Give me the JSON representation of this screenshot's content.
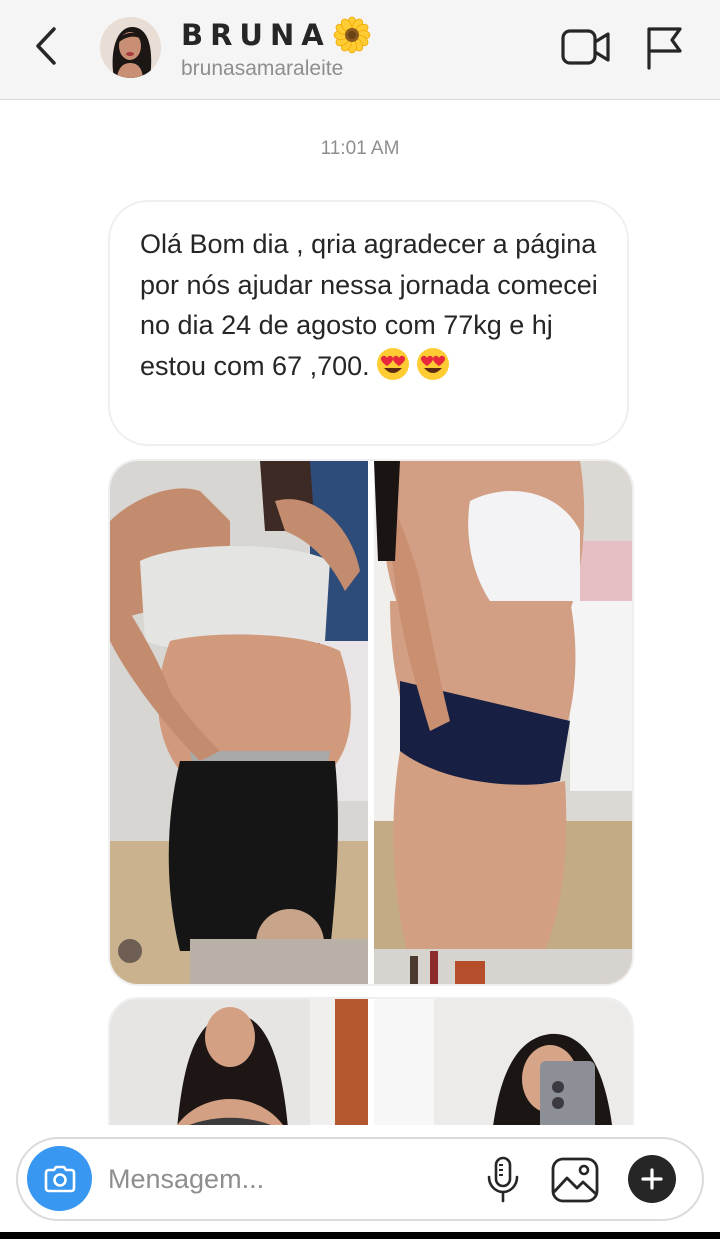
{
  "header": {
    "title": "BRUNA",
    "username": "brunasamaraleite",
    "icons": {
      "back": "chevron-left-icon",
      "video": "video-camera-icon",
      "report": "flag-icon",
      "emoji": "sunflower-emoji"
    }
  },
  "thread": {
    "timestamp": "11:01 AM",
    "messages": [
      {
        "type": "text",
        "text": "Olá Bom dia , qria agradecer a página por nós ajudar nessa jornada comecei no dia 24 de agosto com 77kg e hj estou com 67 ,700.",
        "emojis": [
          "smiling-face-with-heart-eyes",
          "smiling-face-with-heart-eyes"
        ]
      },
      {
        "type": "photo",
        "description_icon": "before-after-photo"
      },
      {
        "type": "photo",
        "description_icon": "before-after-photo"
      }
    ]
  },
  "composer": {
    "placeholder": "Mensagem...",
    "value": "",
    "icons": {
      "camera": "camera-icon",
      "mic": "microphone-icon",
      "gallery": "image-icon",
      "more": "plus-icon"
    },
    "accent": "#3897f0"
  }
}
